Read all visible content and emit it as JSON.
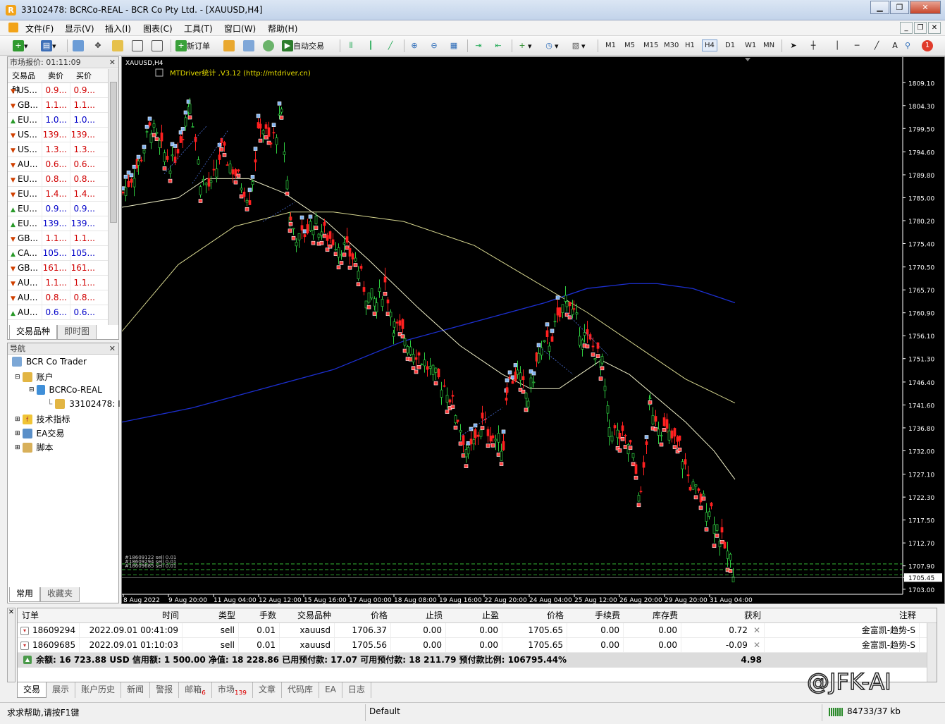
{
  "window": {
    "title": "33102478: BCRCo-REAL - BCR Co Pty Ltd. - [XAUUSD,H4]"
  },
  "menu": [
    "文件(F)",
    "显示(V)",
    "插入(I)",
    "图表(C)",
    "工具(T)",
    "窗口(W)",
    "帮助(H)"
  ],
  "toolbar": {
    "new_order": "新订单",
    "auto_trade": "自动交易",
    "notify_count": "1",
    "timeframes": [
      "M1",
      "M5",
      "M15",
      "M30",
      "H1",
      "H4",
      "D1",
      "W1",
      "MN"
    ],
    "active_tf": "H4"
  },
  "market_watch": {
    "title": "市场报价: 01:11:09",
    "headers": [
      "交易品种",
      "卖价",
      "买价"
    ],
    "rows": [
      {
        "sym": "US...",
        "bid": "0.9...",
        "ask": "0.9...",
        "dir": "down",
        "color": "red"
      },
      {
        "sym": "GB...",
        "bid": "1.1...",
        "ask": "1.1...",
        "dir": "down",
        "color": "red"
      },
      {
        "sym": "EU...",
        "bid": "1.0...",
        "ask": "1.0...",
        "dir": "up",
        "color": "blue"
      },
      {
        "sym": "US...",
        "bid": "139...",
        "ask": "139...",
        "dir": "down",
        "color": "red"
      },
      {
        "sym": "US...",
        "bid": "1.3...",
        "ask": "1.3...",
        "dir": "down",
        "color": "red"
      },
      {
        "sym": "AU...",
        "bid": "0.6...",
        "ask": "0.6...",
        "dir": "down",
        "color": "red"
      },
      {
        "sym": "EU...",
        "bid": "0.8...",
        "ask": "0.8...",
        "dir": "down",
        "color": "red"
      },
      {
        "sym": "EU...",
        "bid": "1.4...",
        "ask": "1.4...",
        "dir": "down",
        "color": "red"
      },
      {
        "sym": "EU...",
        "bid": "0.9...",
        "ask": "0.9...",
        "dir": "up",
        "color": "blue"
      },
      {
        "sym": "EU...",
        "bid": "139...",
        "ask": "139...",
        "dir": "up",
        "color": "blue"
      },
      {
        "sym": "GB...",
        "bid": "1.1...",
        "ask": "1.1...",
        "dir": "down",
        "color": "red"
      },
      {
        "sym": "CA...",
        "bid": "105...",
        "ask": "105...",
        "dir": "up",
        "color": "blue"
      },
      {
        "sym": "GB...",
        "bid": "161...",
        "ask": "161...",
        "dir": "down",
        "color": "red"
      },
      {
        "sym": "AU...",
        "bid": "1.1...",
        "ask": "1.1...",
        "dir": "down",
        "color": "red"
      },
      {
        "sym": "AU...",
        "bid": "0.8...",
        "ask": "0.8...",
        "dir": "down",
        "color": "red"
      },
      {
        "sym": "AU...",
        "bid": "0.6...",
        "ask": "0.6...",
        "dir": "up",
        "color": "blue"
      }
    ],
    "tabs": [
      "交易品种",
      "即时图"
    ]
  },
  "navigator": {
    "title": "导航",
    "items": [
      "BCR Co Trader",
      "账户",
      "BCRCo-REAL",
      "33102478: I",
      "技术指标",
      "EA交易",
      "脚本"
    ],
    "tabs": [
      "常用",
      "收藏夹"
    ]
  },
  "chart": {
    "symbol": "XAUUSD,H4",
    "indicator": "MTDriver统计 ,V3.12 (http://mtdriver.cn)",
    "price_labels": [
      "1809.10",
      "1804.30",
      "1799.50",
      "1794.60",
      "1789.80",
      "1785.00",
      "1780.20",
      "1775.40",
      "1770.50",
      "1765.70",
      "1760.90",
      "1756.10",
      "1751.30",
      "1746.40",
      "1741.60",
      "1736.80",
      "1732.00",
      "1727.10",
      "1722.30",
      "1717.50",
      "1712.70",
      "1707.90",
      "1705.45",
      "1703.00"
    ],
    "current_price": "1705.45",
    "time_labels": [
      "8 Aug 2022",
      "9 Aug 20:00",
      "11 Aug 04:00",
      "12 Aug 12:00",
      "15 Aug 16:00",
      "17 Aug 00:00",
      "18 Aug 08:00",
      "19 Aug 16:00",
      "22 Aug 20:00",
      "24 Aug 04:00",
      "25 Aug 12:00",
      "26 Aug 20:00",
      "29 Aug 20:00",
      "31 Aug 04:00"
    ],
    "order_labels": [
      "#18609122 sell 0.01",
      "#18609294 sell 0.01",
      "#18609685 sell 0.01"
    ]
  },
  "terminal": {
    "headers": [
      "订单",
      "时间",
      "类型",
      "手数",
      "交易品种",
      "价格",
      "止损",
      "止盈",
      "价格",
      "手续费",
      "库存费",
      "获利",
      "注释"
    ],
    "orders": [
      {
        "ticket": "18609294",
        "time": "2022.09.01 00:41:09",
        "type": "sell",
        "lots": "0.01",
        "symbol": "xauusd",
        "open": "1706.37",
        "sl": "0.00",
        "tp": "0.00",
        "price": "1705.65",
        "commission": "0.00",
        "swap": "0.00",
        "profit": "0.72",
        "comment": "金富凯-趋势-S"
      },
      {
        "ticket": "18609685",
        "time": "2022.09.01 01:10:03",
        "type": "sell",
        "lots": "0.01",
        "symbol": "xauusd",
        "open": "1705.56",
        "sl": "0.00",
        "tp": "0.00",
        "price": "1705.65",
        "commission": "0.00",
        "swap": "0.00",
        "profit": "-0.09",
        "comment": "金富凯-趋势-S"
      }
    ],
    "balance_line": "余额: 16 723.88 USD  信用额: 1 500.00  净值: 18 228.86  已用预付款: 17.07  可用预付款: 18 211.79  预付款比例: 106795.44%",
    "total_profit": "4.98",
    "tabs": [
      {
        "label": "交易",
        "badge": ""
      },
      {
        "label": "展示",
        "badge": ""
      },
      {
        "label": "账户历史",
        "badge": ""
      },
      {
        "label": "新闻",
        "badge": ""
      },
      {
        "label": "警报",
        "badge": ""
      },
      {
        "label": "邮箱",
        "badge": "6"
      },
      {
        "label": "市场",
        "badge": "139"
      },
      {
        "label": "文章",
        "badge": ""
      },
      {
        "label": "代码库",
        "badge": ""
      },
      {
        "label": "EA",
        "badge": ""
      },
      {
        "label": "日志",
        "badge": ""
      }
    ]
  },
  "status": {
    "help": "求求帮助,请按F1键",
    "profile": "Default",
    "traffic": "84733/37 kb"
  },
  "watermark": "@JFK-AI",
  "colors": {
    "bull": "#2ecc40",
    "bear": "#ff2020",
    "ma_blue": "#1c2fd0",
    "ma_yellow": "#d8d890"
  }
}
